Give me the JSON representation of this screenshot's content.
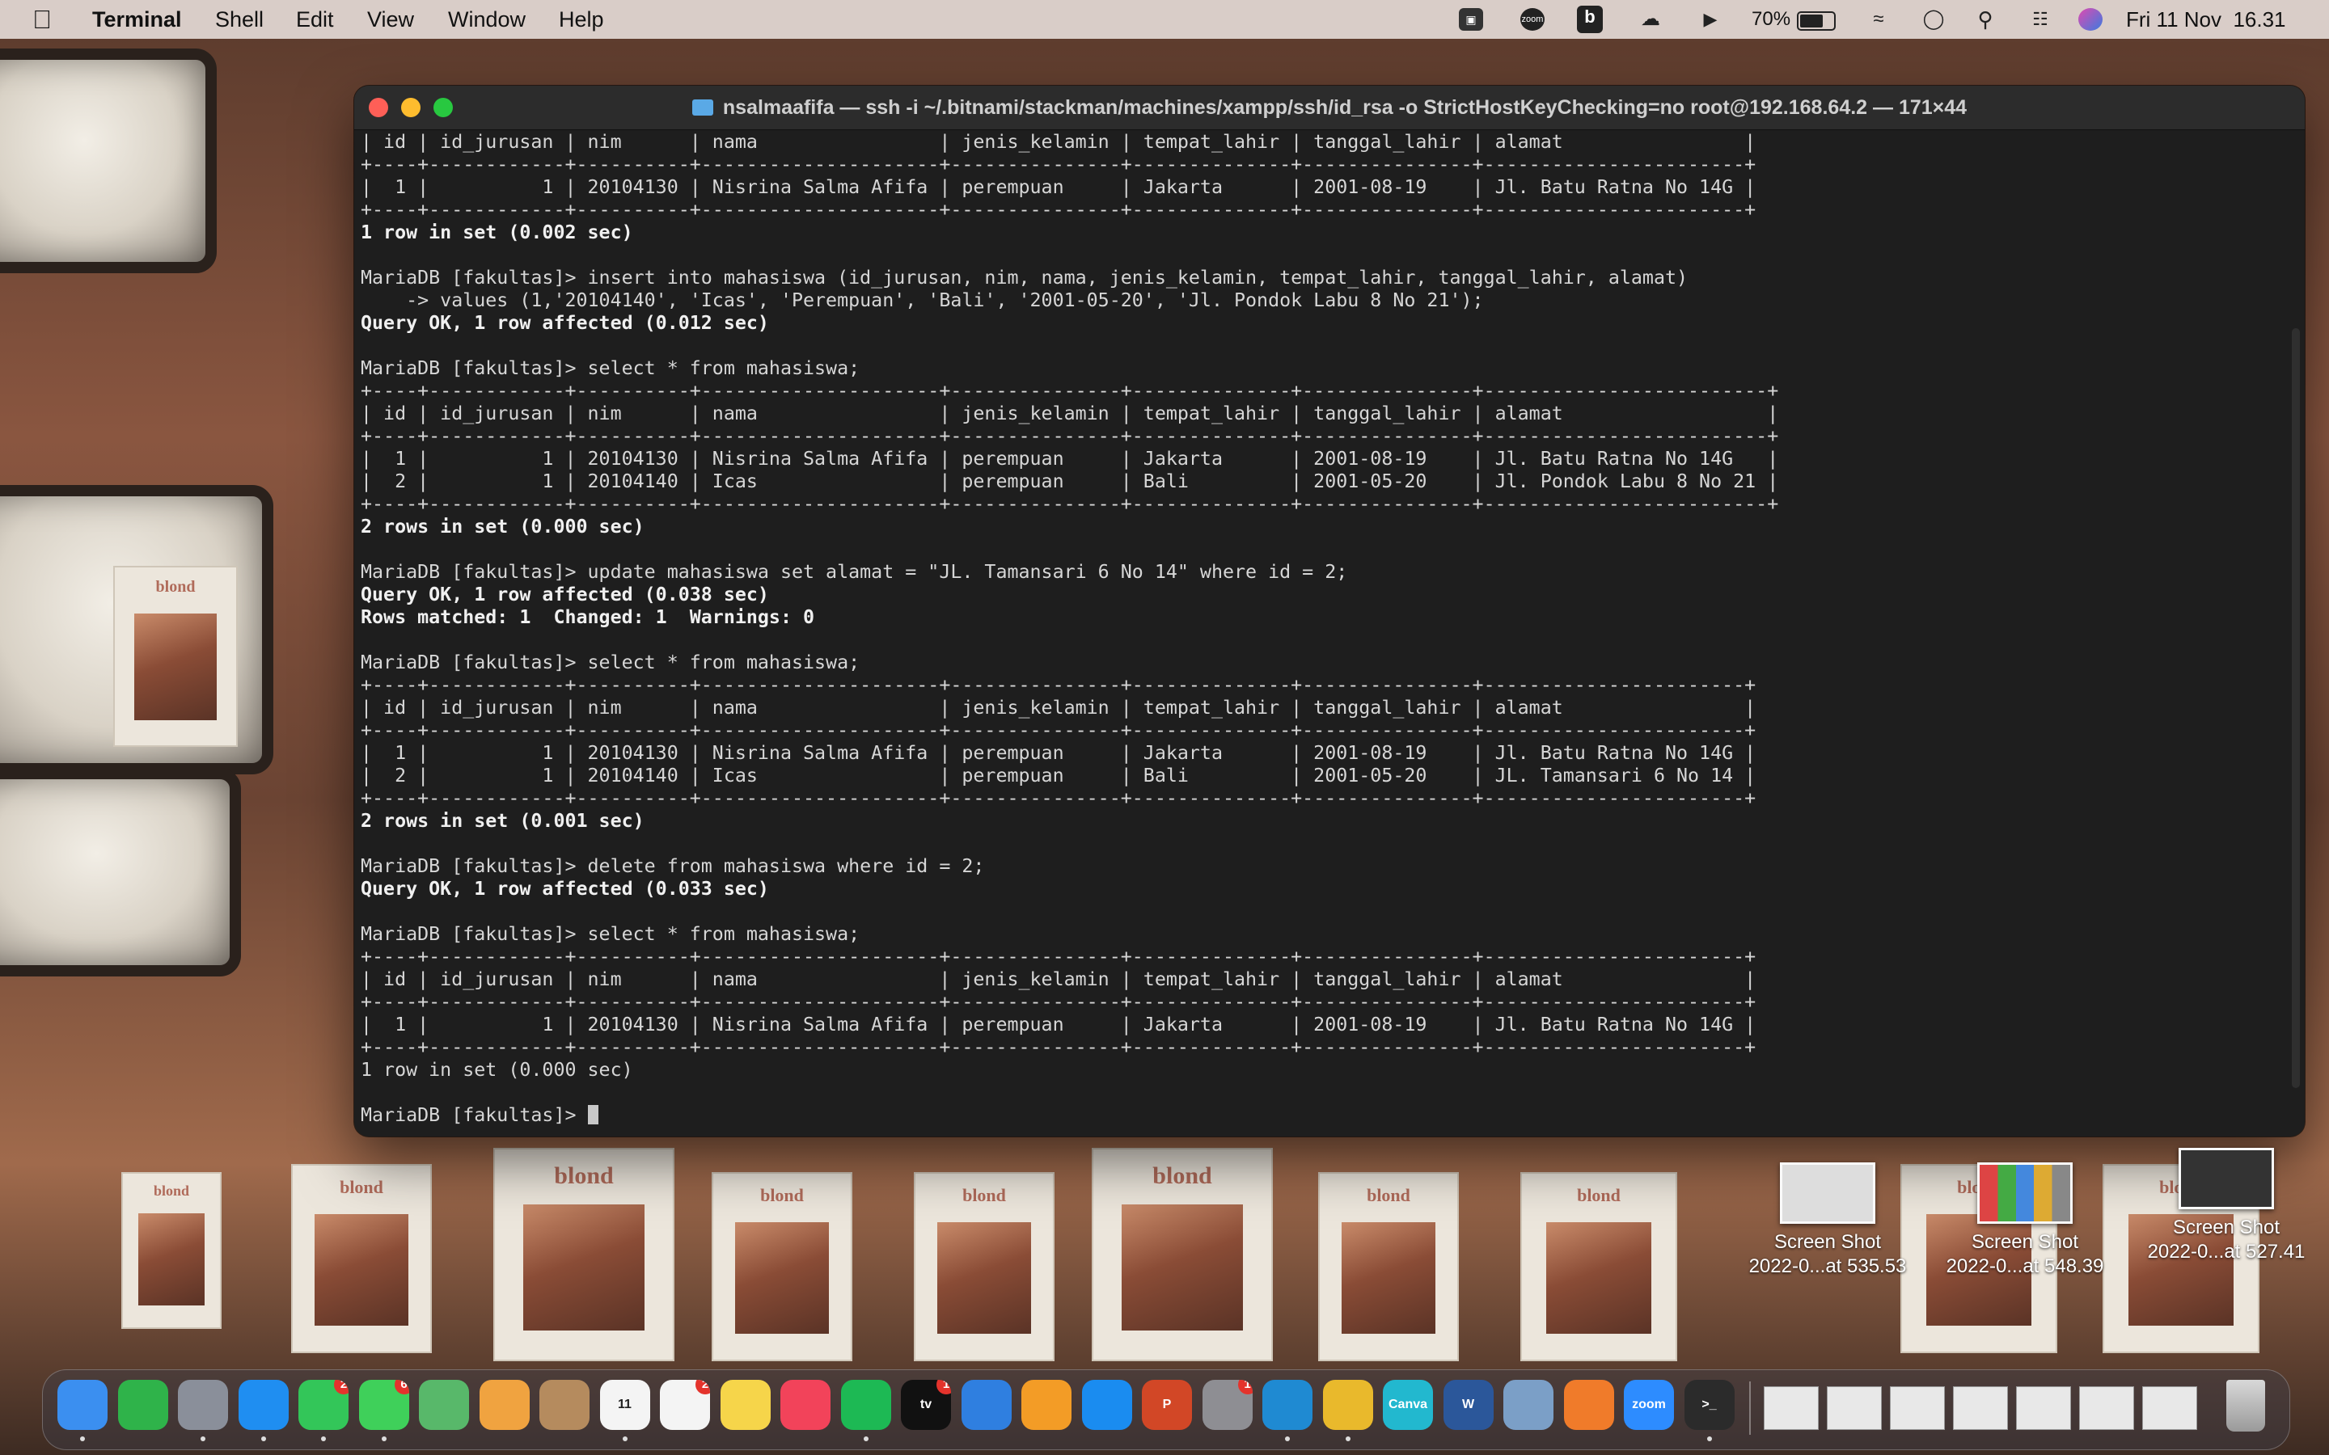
{
  "menubar": {
    "app_name": "Terminal",
    "menus": [
      "Shell",
      "Edit",
      "View",
      "Window",
      "Help"
    ],
    "battery": "70%",
    "clock": "Fri 11 Nov  16.31",
    "zoom_tray": "zoom"
  },
  "terminal": {
    "title": "nsalmaafifa — ssh -i ~/.bitnami/stackman/machines/xampp/ssh/id_rsa -o StrictHostKeyChecking=no root@192.168.64.2 — 171×44",
    "lines": [
      "| id | id_jurusan | nim      | nama                | jenis_kelamin | tempat_lahir | tanggal_lahir | alamat                |",
      "+----+------------+----------+---------------------+---------------+--------------+---------------+-----------------------+",
      "|  1 |          1 | 20104130 | Nisrina Salma Afifa | perempuan     | Jakarta      | 2001-08-19    | Jl. Batu Ratna No 14G |",
      "+----+------------+----------+---------------------+---------------+--------------+---------------+-----------------------+",
      "1 row in set (0.002 sec)",
      "",
      "MariaDB [fakultas]> insert into mahasiswa (id_jurusan, nim, nama, jenis_kelamin, tempat_lahir, tanggal_lahir, alamat)",
      "    -> values (1,'20104140', 'Icas', 'Perempuan', 'Bali', '2001-05-20', 'Jl. Pondok Labu 8 No 21');",
      "Query OK, 1 row affected (0.012 sec)",
      "",
      "MariaDB [fakultas]> select * from mahasiswa;",
      "+----+------------+----------+---------------------+---------------+--------------+---------------+-------------------------+",
      "| id | id_jurusan | nim      | nama                | jenis_kelamin | tempat_lahir | tanggal_lahir | alamat                  |",
      "+----+------------+----------+---------------------+---------------+--------------+---------------+-------------------------+",
      "|  1 |          1 | 20104130 | Nisrina Salma Afifa | perempuan     | Jakarta      | 2001-08-19    | Jl. Batu Ratna No 14G   |",
      "|  2 |          1 | 20104140 | Icas                | perempuan     | Bali         | 2001-05-20    | Jl. Pondok Labu 8 No 21 |",
      "+----+------------+----------+---------------------+---------------+--------------+---------------+-------------------------+",
      "2 rows in set (0.000 sec)",
      "",
      "MariaDB [fakultas]> update mahasiswa set alamat = \"JL. Tamansari 6 No 14\" where id = 2;",
      "Query OK, 1 row affected (0.038 sec)",
      "Rows matched: 1  Changed: 1  Warnings: 0",
      "",
      "MariaDB [fakultas]> select * from mahasiswa;",
      "+----+------------+----------+---------------------+---------------+--------------+---------------+-----------------------+",
      "| id | id_jurusan | nim      | nama                | jenis_kelamin | tempat_lahir | tanggal_lahir | alamat                |",
      "+----+------------+----------+---------------------+---------------+--------------+---------------+-----------------------+",
      "|  1 |          1 | 20104130 | Nisrina Salma Afifa | perempuan     | Jakarta      | 2001-08-19    | Jl. Batu Ratna No 14G |",
      "|  2 |          1 | 20104140 | Icas                | perempuan     | Bali         | 2001-05-20    | JL. Tamansari 6 No 14 |",
      "+----+------------+----------+---------------------+---------------+--------------+---------------+-----------------------+",
      "2 rows in set (0.001 sec)",
      "",
      "MariaDB [fakultas]> delete from mahasiswa where id = 2;",
      "Query OK, 1 row affected (0.033 sec)",
      "",
      "MariaDB [fakultas]> select * from mahasiswa;",
      "+----+------------+----------+---------------------+---------------+--------------+---------------+-----------------------+",
      "| id | id_jurusan | nim      | nama                | jenis_kelamin | tempat_lahir | tanggal_lahir | alamat                |",
      "+----+------------+----------+---------------------+---------------+--------------+---------------+-----------------------+",
      "|  1 |          1 | 20104130 | Nisrina Salma Afifa | perempuan     | Jakarta      | 2001-08-19    | Jl. Batu Ratna No 14G |",
      "+----+------------+----------+---------------------+---------------+--------------+---------------+-----------------------+",
      "1 row in set (0.000 sec)",
      "",
      "MariaDB [fakultas]> "
    ],
    "bold_lines": [
      4,
      8,
      17,
      20,
      21,
      30,
      33,
      42
    ]
  },
  "desktop": {
    "wallpaper_word": "blond",
    "screenshots": [
      {
        "line1": "Screen Shot",
        "line2": "2022-0...at 535.53"
      },
      {
        "line1": "Screen Shot",
        "line2": "2022-0...at 548.39"
      },
      {
        "line1": "Screen Shot",
        "line2": "2022-0...at 527.41"
      }
    ]
  },
  "dock": {
    "apps": [
      {
        "name": "finder",
        "label": "",
        "color": "#3b8ff0",
        "badge": ""
      },
      {
        "name": "numbers",
        "label": "",
        "color": "#2fb34a",
        "badge": ""
      },
      {
        "name": "launchpad",
        "label": "",
        "color": "#8a8f9a",
        "badge": ""
      },
      {
        "name": "safari",
        "label": "",
        "color": "#1f8ef1",
        "badge": ""
      },
      {
        "name": "facetime",
        "label": "",
        "color": "#33c659",
        "badge": "2"
      },
      {
        "name": "messages",
        "label": "",
        "color": "#3fd05a",
        "badge": "6"
      },
      {
        "name": "maps",
        "label": "",
        "color": "#58b86a",
        "badge": ""
      },
      {
        "name": "photos",
        "label": "",
        "color": "#f0a340",
        "badge": ""
      },
      {
        "name": "contacts",
        "label": "",
        "color": "#b58b5e",
        "badge": ""
      },
      {
        "name": "calendar",
        "label": "11",
        "color": "#f4f4f4",
        "badge": ""
      },
      {
        "name": "reminders",
        "label": "",
        "color": "#f4f4f4",
        "badge": "2"
      },
      {
        "name": "notes",
        "label": "",
        "color": "#f6d54a",
        "badge": ""
      },
      {
        "name": "music",
        "label": "",
        "color": "#f2435a",
        "badge": ""
      },
      {
        "name": "spotify",
        "label": "",
        "color": "#1db954",
        "badge": ""
      },
      {
        "name": "apple-tv",
        "label": "tv",
        "color": "#111111",
        "badge": "1"
      },
      {
        "name": "keynote",
        "label": "",
        "color": "#2f7fe0",
        "badge": ""
      },
      {
        "name": "pages",
        "label": "",
        "color": "#f39c26",
        "badge": ""
      },
      {
        "name": "app-store",
        "label": "",
        "color": "#1a8cf0",
        "badge": ""
      },
      {
        "name": "powerpoint",
        "label": "P",
        "color": "#d24726",
        "badge": ""
      },
      {
        "name": "system-preferences",
        "label": "",
        "color": "#8e8e93",
        "badge": "1"
      },
      {
        "name": "vscode",
        "label": "",
        "color": "#1f8ad2",
        "badge": ""
      },
      {
        "name": "chrome",
        "label": "",
        "color": "#e9b92c",
        "badge": ""
      },
      {
        "name": "canva",
        "label": "Canva",
        "color": "#22b8cf",
        "badge": ""
      },
      {
        "name": "word",
        "label": "W",
        "color": "#2b579a",
        "badge": ""
      },
      {
        "name": "preview",
        "label": "",
        "color": "#7b9fc7",
        "badge": ""
      },
      {
        "name": "xampp",
        "label": "",
        "color": "#f07b2a",
        "badge": ""
      },
      {
        "name": "zoom",
        "label": "zoom",
        "color": "#2d8cff",
        "badge": ""
      },
      {
        "name": "terminal",
        "label": ">_",
        "color": "#2b2b2b",
        "badge": ""
      }
    ],
    "recent_windows": 7
  }
}
